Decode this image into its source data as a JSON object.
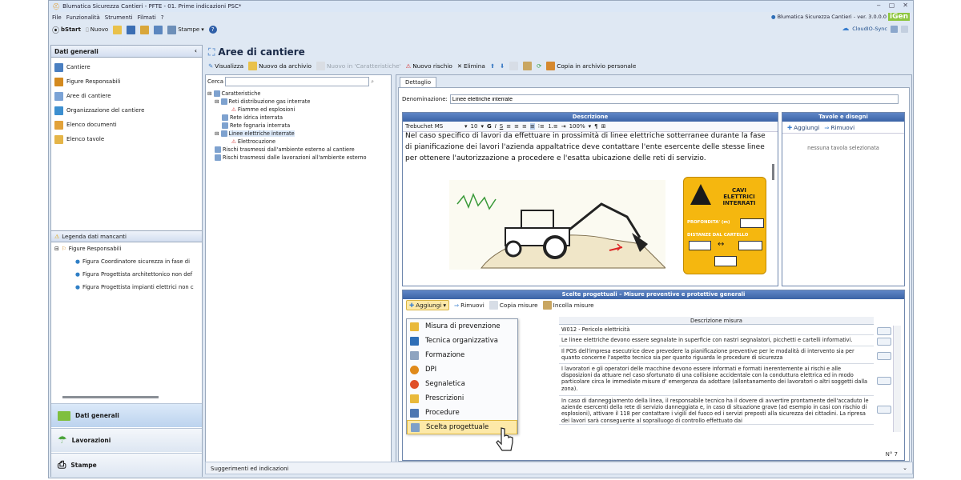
{
  "window": {
    "title": "Blumatica Sicurezza Cantieri - PFTE - 01. Prime indicazioni PSC*",
    "version": "Blumatica Sicurezza Cantieri - ver. 3.0.0.0",
    "brand": "iGen",
    "buttons": [
      "‒",
      "▢",
      "✕"
    ]
  },
  "menubar": {
    "items": [
      "File",
      "Funzionalità",
      "Strumenti",
      "Filmati",
      "?"
    ]
  },
  "toolbar": {
    "start": "bStart",
    "nuovo": "Nuovo",
    "stampe": "Stampe",
    "cloud": "CloudIO-Sync"
  },
  "sidebar": {
    "header": "Dati generali",
    "collapse": "‹",
    "items": [
      {
        "label": "Cantiere",
        "icon": "cantiere-icon",
        "color": "#4a7fc1"
      },
      {
        "label": "Figure Responsabili",
        "icon": "figure-icon",
        "color": "#d48a1f"
      },
      {
        "label": "Aree di cantiere",
        "icon": "area-icon",
        "color": "#7ba3d6"
      },
      {
        "label": "Organizzazione del cantiere",
        "icon": "org-icon",
        "color": "#3c8fd0"
      },
      {
        "label": "Elenco documenti",
        "icon": "docs-icon",
        "color": "#e2a23a"
      },
      {
        "label": "Elenco tavole",
        "icon": "tavole-icon",
        "color": "#e5b548"
      }
    ],
    "legend": {
      "header": "Legenda dati mancanti",
      "group": "Figure Responsabili",
      "rows": [
        "Figura Coordinatore sicurezza in fase di",
        "Figura Progettista architettonico non def",
        "Figura Progettista impianti elettrici non c"
      ]
    },
    "nav": [
      "Dati generali",
      "Lavorazioni",
      "Stampe"
    ]
  },
  "main": {
    "title": "Aree di cantiere",
    "commands": {
      "visualizza": "Visualizza",
      "nuovo_archivio": "Nuovo da archivio",
      "nuovo_caratteristiche": "Nuovo in 'Caratteristiche'",
      "nuovo_rischio": "Nuovo rischio",
      "elimina": "Elimina",
      "copia_archivio": "Copia in archivio personale"
    },
    "search_label": "Cerca",
    "tree": [
      {
        "label": "Caratteristiche",
        "level": 0,
        "type": "folder"
      },
      {
        "label": "Reti distribuzione gas interrate",
        "level": 1,
        "type": "item"
      },
      {
        "label": "Fiamme ed esplosioni",
        "level": 2,
        "type": "risk"
      },
      {
        "label": "Rete idrica interrata",
        "level": 1,
        "type": "item"
      },
      {
        "label": "Rete fognaria interrata",
        "level": 1,
        "type": "item"
      },
      {
        "label": "Linee elettriche interrate",
        "level": 1,
        "type": "item"
      },
      {
        "label": "Elettrocuzione",
        "level": 2,
        "type": "risk"
      },
      {
        "label": "Rischi trasmessi dall'ambiente esterno al cantiere",
        "level": 0,
        "type": "folder"
      },
      {
        "label": "Rischi trasmessi dalle lavorazioni all'ambiente esterno",
        "level": 0,
        "type": "folder"
      }
    ],
    "detail": {
      "tab": "Dettaglio",
      "denominazione_label": "Denominazione:",
      "denominazione_value": "Linee elettriche interrate",
      "descrizione_header": "Descrizione",
      "rte": {
        "font": "Trebuchet MS",
        "size": "10",
        "zoom": "100%"
      },
      "descrizione_text": "Nel caso specifico di lavori da effettuare in prossimità di linee elettriche sotterranee durante la fase di pianificazione dei lavori l'azienda appaltatrice deve contattare l'ente esercente delle stesse linee per ottenere l'autorizzazione a procedere e l'esatta ubicazione delle reti di servizio.",
      "sign": {
        "title_lines": [
          "CAVI",
          "ELETTRICI",
          "INTERRATI"
        ],
        "profondita": "PROFONDITA' (m)",
        "distanze": "DISTANZE DAL CARTELLO"
      },
      "tavole": {
        "header": "Tavole e disegni",
        "aggiungi": "Aggiungi",
        "rimuovi": "Rimuovi",
        "empty": "nessuna tavola selezionata"
      },
      "scelte": {
        "header": "Scelte progettuali – Misure preventive e protettive generali",
        "aggiungi": "Aggiungi",
        "rimuovi": "Rimuovi",
        "copia": "Copia misure",
        "incolla": "Incolla misure",
        "column": "Descrizione misura",
        "rows": [
          "W012 - Pericolo elettricità",
          "Le linee elettriche devono essere segnalate in superficie con nastri segnalatori, picchetti e cartelli informativi.",
          "Il POS  dell'impresa esecutrice deve prevedere la pianificazione preventive per le modalità di intervento sia per quanto concerne l'aspetto tecnico sia per quanto riguarda le procedure di sicurezza",
          "I lavoratori e gli operatori delle macchine devono essere informati e formati inerentemente ai rischi e alle disposizioni da attuare nel caso sfortunato di una collisione accidentale con la conduttura elettrica  ed in modo particolare circa le immediate misure d' emergenza da adottare (allontanamento dei lavoratori o altri soggetti dalla zona).",
          "In caso di danneggiamento della linea, il responsabile tecnico ha il dovere di avvertire prontamente dell'accaduto le aziende esercenti della rete di servizio danneggiata e, in caso di situazione grave (ad esempio in casi con rischio di esplosioni), attivare il 118 per contattare i vigili del fuoco ed i servizi preposti alla sicurezza dei cittadini. La ripresa dei lavori sarà conseguente al sopralluogo di controllo effettuato dai"
        ],
        "count": "N° 7"
      }
    },
    "dropdown": [
      {
        "label": "Misura di prevenzione",
        "icon": "misura-icon",
        "color": "#e9b93a"
      },
      {
        "label": "Tecnica organizzativa",
        "icon": "tecnica-icon",
        "color": "#2f6fb7"
      },
      {
        "label": "Formazione",
        "icon": "formazione-icon",
        "color": "#8ea4c0"
      },
      {
        "label": "DPI",
        "icon": "dpi-icon",
        "color": "#e08a1a"
      },
      {
        "label": "Segnaletica",
        "icon": "segnaletica-icon",
        "color": "#e05028"
      },
      {
        "label": "Prescrizioni",
        "icon": "prescrizioni-icon",
        "color": "#e9b93a"
      },
      {
        "label": "Procedure",
        "icon": "procedure-icon",
        "color": "#4e78b2"
      },
      {
        "label": "Scelta progettuale",
        "icon": "scelta-icon",
        "color": "#7fa0c8"
      }
    ],
    "status": "Suggerimenti ed indicazioni"
  }
}
